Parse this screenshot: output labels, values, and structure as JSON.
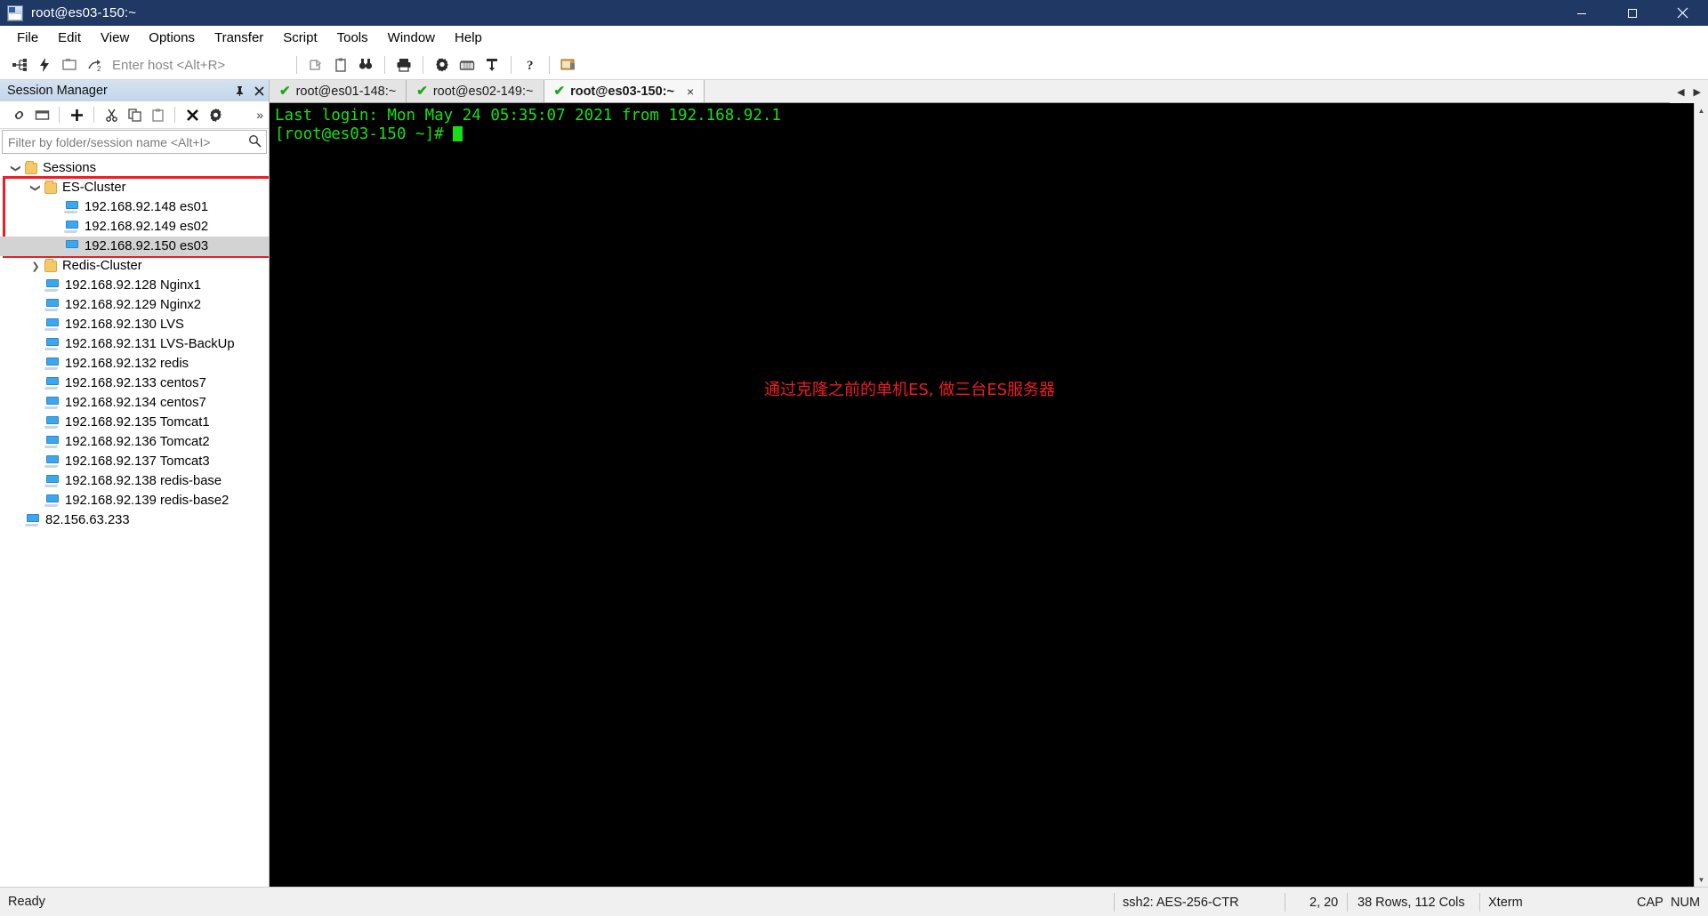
{
  "window": {
    "title": "root@es03-150:~",
    "app_icon": "securecrt-icon",
    "minimize": "minimize-button",
    "maximize": "maximize-button",
    "close": "close-button"
  },
  "menu": {
    "items": [
      "File",
      "Edit",
      "View",
      "Options",
      "Transfer",
      "Script",
      "Tools",
      "Window",
      "Help"
    ]
  },
  "toolbar": {
    "host_placeholder": "Enter host <Alt+R>",
    "buttons": [
      "connect-icon",
      "quick-connect-icon",
      "connect-in-tab-icon",
      "reconnect-icon",
      "clone-session-icon",
      "copy-icon",
      "find-icon",
      "print-icon",
      "session-options-icon",
      "keymap-editor-icon",
      "line-tool-icon",
      "help-icon",
      "securecrt-icon"
    ]
  },
  "session_manager": {
    "header_title": "Session Manager",
    "pin_label": "pin-panel",
    "close_label": "close-panel",
    "toolbar_buttons": [
      "connect-icon",
      "new-window-icon",
      "new-session-icon",
      "cut-icon",
      "copy-icon",
      "paste-icon",
      "delete-icon",
      "properties-icon"
    ],
    "overflow": "»",
    "filter_placeholder": "Filter by folder/session name <Alt+I>",
    "search_icon": "search-icon",
    "tree": [
      {
        "label": "Sessions",
        "type": "folder",
        "indent": 0,
        "twisty": "expanded",
        "selected": false
      },
      {
        "label": "ES-Cluster",
        "type": "folder",
        "indent": 1,
        "twisty": "expanded",
        "selected": false
      },
      {
        "label": "192.168.92.148 es01",
        "type": "session",
        "indent": 2,
        "twisty": "none",
        "selected": false
      },
      {
        "label": "192.168.92.149 es02",
        "type": "session",
        "indent": 2,
        "twisty": "none",
        "selected": false
      },
      {
        "label": "192.168.92.150 es03",
        "type": "session",
        "indent": 2,
        "twisty": "none",
        "selected": true
      },
      {
        "label": "Redis-Cluster",
        "type": "folder",
        "indent": 1,
        "twisty": "collapsed",
        "selected": false
      },
      {
        "label": "192.168.92.128  Nginx1",
        "type": "session",
        "indent": 1,
        "twisty": "none",
        "selected": false
      },
      {
        "label": "192.168.92.129  Nginx2",
        "type": "session",
        "indent": 1,
        "twisty": "none",
        "selected": false
      },
      {
        "label": "192.168.92.130  LVS",
        "type": "session",
        "indent": 1,
        "twisty": "none",
        "selected": false
      },
      {
        "label": "192.168.92.131  LVS-BackUp",
        "type": "session",
        "indent": 1,
        "twisty": "none",
        "selected": false
      },
      {
        "label": "192.168.92.132  redis",
        "type": "session",
        "indent": 1,
        "twisty": "none",
        "selected": false
      },
      {
        "label": "192.168.92.133  centos7",
        "type": "session",
        "indent": 1,
        "twisty": "none",
        "selected": false
      },
      {
        "label": "192.168.92.134  centos7",
        "type": "session",
        "indent": 1,
        "twisty": "none",
        "selected": false
      },
      {
        "label": "192.168.92.135  Tomcat1",
        "type": "session",
        "indent": 1,
        "twisty": "none",
        "selected": false
      },
      {
        "label": "192.168.92.136  Tomcat2",
        "type": "session",
        "indent": 1,
        "twisty": "none",
        "selected": false
      },
      {
        "label": "192.168.92.137  Tomcat3",
        "type": "session",
        "indent": 1,
        "twisty": "none",
        "selected": false
      },
      {
        "label": "192.168.92.138  redis-base",
        "type": "session",
        "indent": 1,
        "twisty": "none",
        "selected": false
      },
      {
        "label": "192.168.92.139  redis-base2",
        "type": "session",
        "indent": 1,
        "twisty": "none",
        "selected": false
      },
      {
        "label": "82.156.63.233",
        "type": "session",
        "indent": 0,
        "twisty": "none",
        "selected": false
      }
    ]
  },
  "tabs": {
    "items": [
      {
        "label": "root@es01-148:~",
        "active": false,
        "status_icon": "connected-check-icon"
      },
      {
        "label": "root@es02-149:~",
        "active": false,
        "status_icon": "connected-check-icon"
      },
      {
        "label": "root@es03-150:~",
        "active": true,
        "status_icon": "connected-check-icon"
      }
    ],
    "close_label": "×",
    "nav_left": "◀",
    "nav_right": "▶"
  },
  "terminal": {
    "lines": [
      "Last login: Mon May 24 05:35:07 2021 from 192.168.92.1",
      "[root@es03-150 ~]# "
    ],
    "annotation": "通过克隆之前的单机ES, 做三台ES服务器",
    "annotation_color": "#ee1c25",
    "text_color": "#18e018",
    "background": "#000000"
  },
  "statusbar": {
    "ready": "Ready",
    "protocol": "ssh2: AES-256-CTR",
    "cursor_pos": "2, 20",
    "dimensions": "38 Rows, 112 Cols",
    "emulation": "Xterm",
    "caps": "CAP",
    "num": "NUM"
  },
  "annotations": {
    "red_box_color": "#ee1c25"
  }
}
